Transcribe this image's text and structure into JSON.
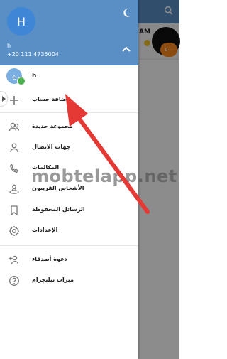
{
  "background_chat": {
    "preview_title": "AM",
    "badge_text": "٥٠٠"
  },
  "drawer": {
    "avatar_letter": "H",
    "user_name": "h",
    "phone": "+20 111 4735004",
    "account": {
      "avatar_letter": "ع",
      "name": "h"
    },
    "add_account_label": "إضافة حساب",
    "menu": [
      {
        "id": "new-group",
        "label": "مجموعة جديدة",
        "icon": "group-icon"
      },
      {
        "id": "contacts",
        "label": "جهات الاتصال",
        "icon": "person-icon"
      },
      {
        "id": "calls",
        "label": "المكالمات",
        "icon": "phone-icon"
      },
      {
        "id": "people-nearby",
        "label": "الأشخاص القريبون",
        "icon": "people-nearby-icon"
      },
      {
        "id": "saved-messages",
        "label": "الرسائل المحفوظة",
        "icon": "bookmark-icon"
      },
      {
        "id": "settings",
        "label": "الإعدادات",
        "icon": "gear-icon"
      }
    ],
    "secondary_menu": [
      {
        "id": "invite-friends",
        "label": "دعوة أصدقاء",
        "icon": "add-person-icon"
      },
      {
        "id": "telegram-features",
        "label": "ميزات تيليجرام",
        "icon": "help-icon"
      }
    ]
  },
  "watermark": "mobtelapp.net",
  "colors": {
    "header": "#5a8fc6",
    "arrow": "#e53935",
    "badge": "#ff8a1e"
  }
}
